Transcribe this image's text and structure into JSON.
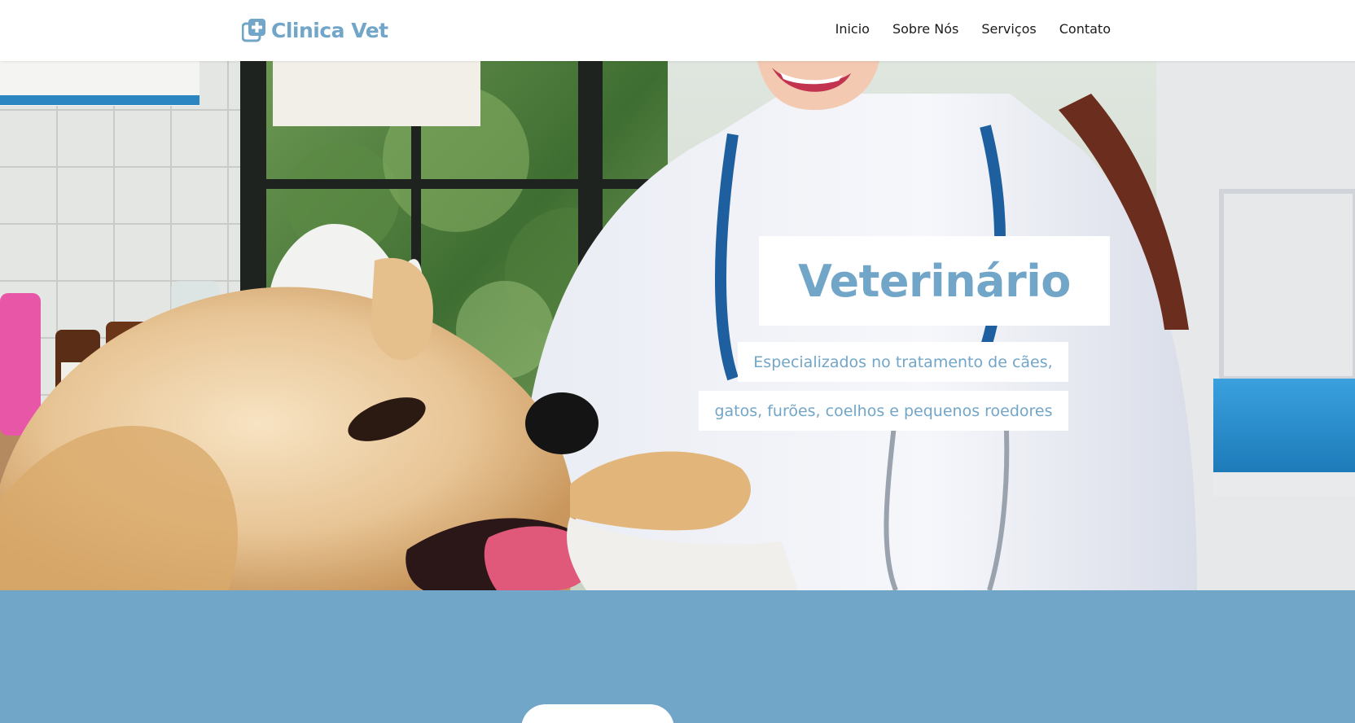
{
  "header": {
    "logo_text": "Clinica Vet",
    "logo_icon": "medical-plus-icon",
    "nav": [
      {
        "label": "Inicio"
      },
      {
        "label": "Sobre Nós"
      },
      {
        "label": "Serviços"
      },
      {
        "label": "Contato"
      }
    ]
  },
  "hero": {
    "title": "Veterinário",
    "subtitle_line1": "Especializados no tratamento de cães,",
    "subtitle_line2": "gatos, furões, coelhos e pequenos roedores",
    "image": "veterinarian-with-dog-photo"
  },
  "colors": {
    "accent": "#72a6c9",
    "nav_text": "#1b1b1b",
    "background": "#ffffff"
  }
}
